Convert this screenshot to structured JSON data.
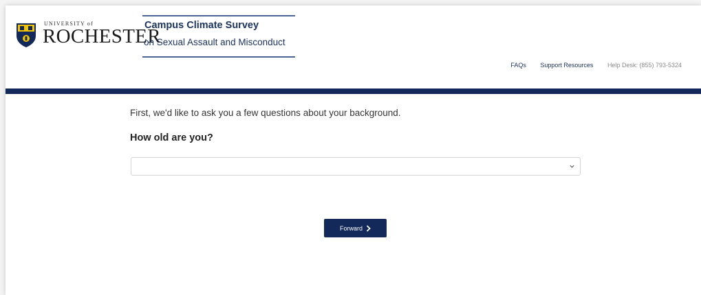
{
  "brand": {
    "university_small": "UNIVERSITY of",
    "university_name": "ROCHESTER",
    "survey_title": "Campus Climate Survey",
    "survey_subtitle": "on Sexual Assault and Misconduct"
  },
  "nav": {
    "faqs": "FAQs",
    "support_resources": "Support Resources",
    "help_desk": "Help Desk: (855) 793-5324"
  },
  "main": {
    "intro": "First, we'd like to ask you a few questions about your background.",
    "question": "How old are you?",
    "age_select_value": ""
  },
  "buttons": {
    "forward_label": "Forward"
  },
  "colors": {
    "navy": "#13295a",
    "title_blue": "#1c3461",
    "seal_yellow": "#f2c500"
  },
  "icons": {
    "seal": "university-seal-icon",
    "dropdown": "chevron-down-icon",
    "forward": "chevron-right-icon"
  }
}
